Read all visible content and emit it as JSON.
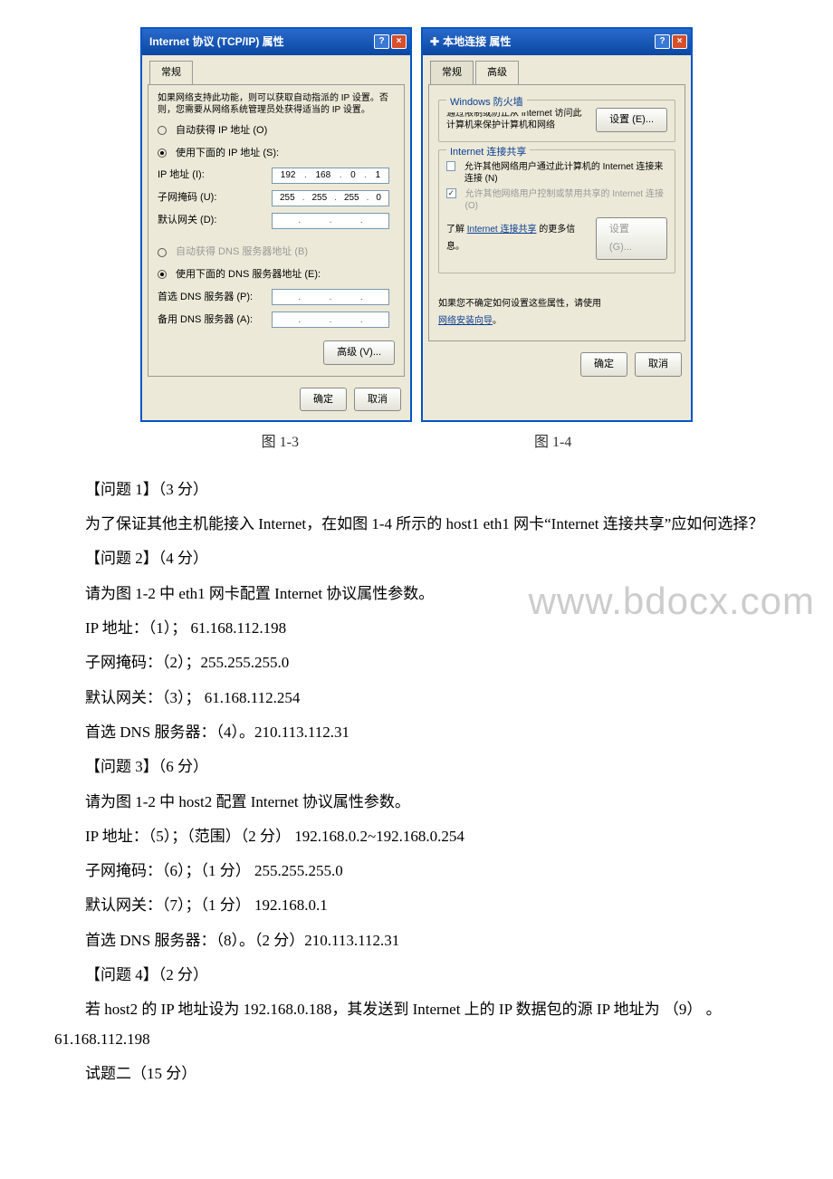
{
  "dialogs": {
    "tcpip": {
      "title": "Internet 协议 (TCP/IP) 属性",
      "tab_general": "常规",
      "note": "如果网络支持此功能，则可以获取自动指派的 IP 设置。否则，您需要从网络系统管理员处获得适当的 IP 设置。",
      "opt_auto_ip": "自动获得 IP 地址 (O)",
      "opt_manual_ip": "使用下面的 IP 地址 (S):",
      "lab_ip": "IP 地址 (I):",
      "val_ip": [
        "192",
        "168",
        "0",
        "1"
      ],
      "lab_mask": "子网掩码 (U):",
      "val_mask": [
        "255",
        "255",
        "255",
        "0"
      ],
      "lab_gw": "默认网关 (D):",
      "opt_auto_dns": "自动获得 DNS 服务器地址 (B)",
      "opt_manual_dns": "使用下面的 DNS 服务器地址 (E):",
      "lab_dns1": "首选 DNS 服务器 (P):",
      "lab_dns2": "备用 DNS 服务器 (A):",
      "btn_adv": "高级 (V)...",
      "btn_ok": "确定",
      "btn_cancel": "取消"
    },
    "local": {
      "title": "本地连接 属性",
      "tab_general": "常规",
      "tab_adv": "高级",
      "fw_legend": "Windows 防火墙",
      "fw_text": "通过限制或防止从 Internet 访问此计算机来保护计算机和网络",
      "btn_setting": "设置 (E)...",
      "ics_legend": "Internet 连接共享",
      "ics_opt1": "允许其他网络用户通过此计算机的 Internet 连接来连接 (N)",
      "ics_opt2": "允许其他网络用户控制或禁用共享的 Internet 连接 (O)",
      "ics_learn_pre": "了解",
      "ics_learn_link": "Internet 连接共享",
      "ics_learn_post": "的更多信息。",
      "btn_setting2": "设置 (G)...",
      "wizard_text_pre": "如果您不确定如何设置这些属性，请使用",
      "wizard_link": "网络安装向导",
      "wizard_text_post": "。",
      "btn_ok": "确定",
      "btn_cancel": "取消"
    }
  },
  "captions": {
    "left": "图 1-3",
    "right": "图 1-4"
  },
  "watermark": "www.bdocx.com",
  "doc": {
    "q1_title": "【问题 1】（3 分）",
    "q1_body": "为了保证其他主机能接入 Internet，在如图 1-4 所示的 host1 eth1 网卡“Internet 连接共享”应如何选择？",
    "q2_title": "【问题 2】（4 分）",
    "q2_body": "请为图 1-2 中 eth1 网卡配置 Internet 协议属性参数。",
    "q2_ip": "IP 地址：（1）； 61.168.112.198",
    "q2_mask": "子网掩码：（2）；255.255.255.0",
    "q2_gw": "默认网关：（3）； 61.168.112.254",
    "q2_dns": "首选 DNS 服务器：（4）。210.113.112.31",
    "q3_title": "【问题 3】（6 分）",
    "q3_body": "请为图 1-2 中 host2 配置 Internet 协议属性参数。",
    "q3_ip": "IP 地址：（5）；（范围）（2 分） 192.168.0.2~192.168.0.254",
    "q3_mask": "子网掩码：（6）；（1 分） 255.255.255.0",
    "q3_gw": "默认网关：（7）；（1 分） 192.168.0.1",
    "q3_dns": "首选 DNS 服务器：（8）。（2 分）210.113.112.31",
    "q4_title": "【问题 4】（2 分）",
    "q4_body": "若 host2 的 IP 地址设为 192.168.0.188，其发送到 Internet 上的 IP 数据包的源 IP 地址为 （9） 。61.168.112.198",
    "s2_title": "试题二（15 分）"
  }
}
